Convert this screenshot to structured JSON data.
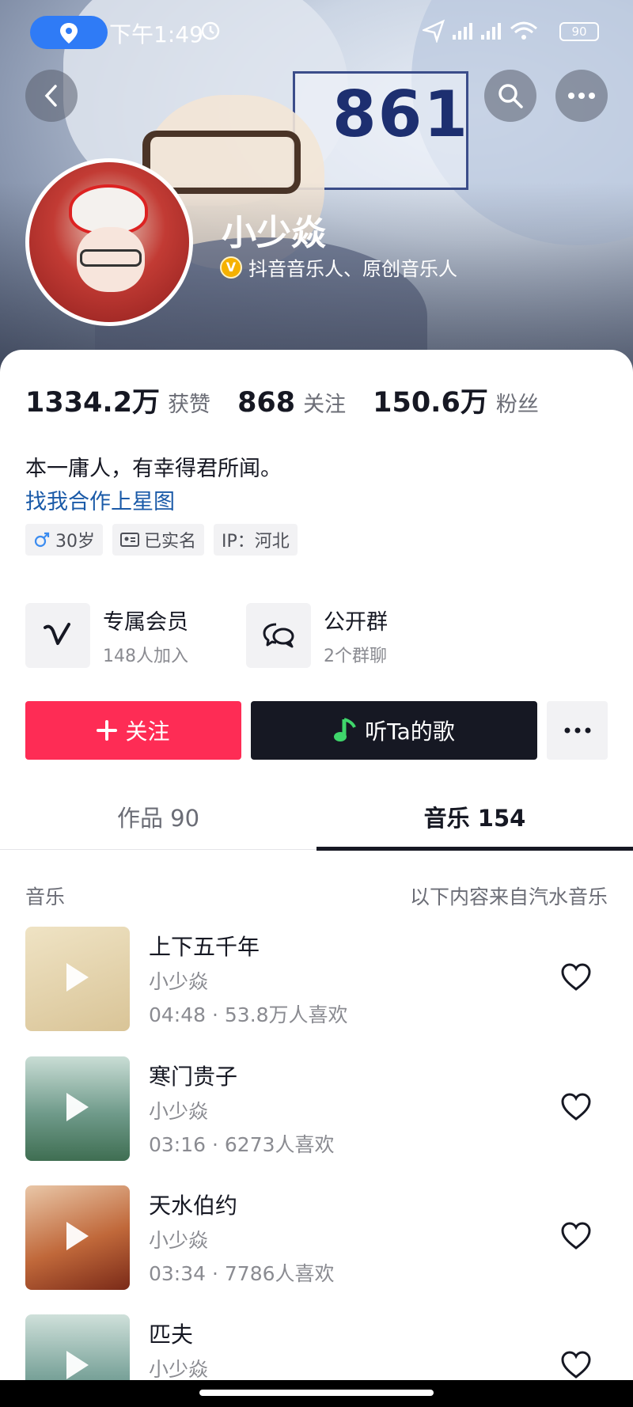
{
  "status_bar": {
    "time": "下午1:49",
    "battery": "90"
  },
  "profile": {
    "name": "小少焱",
    "verified_text": "抖音音乐人、原创音乐人",
    "banner_number": "861",
    "stats": [
      {
        "value": "1334.2万",
        "label": "获赞"
      },
      {
        "value": "868",
        "label": "关注"
      },
      {
        "value": "150.6万",
        "label": "粉丝"
      }
    ],
    "bio": "本一庸人，有幸得君所闻。",
    "collab_link": "找我合作上星图",
    "tags": [
      "30岁",
      "已实名",
      "IP：河北"
    ]
  },
  "features": [
    {
      "title": "专属会员",
      "subtitle": "148人加入",
      "icon": "v-membership-icon"
    },
    {
      "title": "公开群",
      "subtitle": "2个群聊",
      "icon": "group-chat-icon"
    }
  ],
  "actions": {
    "follow": "关注",
    "listen": "听Ta的歌"
  },
  "tabs": [
    {
      "label": "作品 90",
      "active": false
    },
    {
      "label": "音乐 154",
      "active": true
    }
  ],
  "music_section": {
    "title": "音乐",
    "source": "以下内容来自汽水音乐"
  },
  "songs": [
    {
      "title": "上下五千年",
      "artist": "小少焱",
      "meta": "04:48 · 53.8万人喜欢",
      "cover_color": "#e6d5ad"
    },
    {
      "title": "寒门贵子",
      "artist": "小少焱",
      "meta": "03:16 · 6273人喜欢",
      "cover_color": "#6f9a8a"
    },
    {
      "title": "天水伯约",
      "artist": "小少焱",
      "meta": "03:34 · 7786人喜欢",
      "cover_color": "#b0502a"
    },
    {
      "title": "匹夫",
      "artist": "小少焱",
      "meta": "",
      "cover_color": "#7aa39a"
    }
  ]
}
